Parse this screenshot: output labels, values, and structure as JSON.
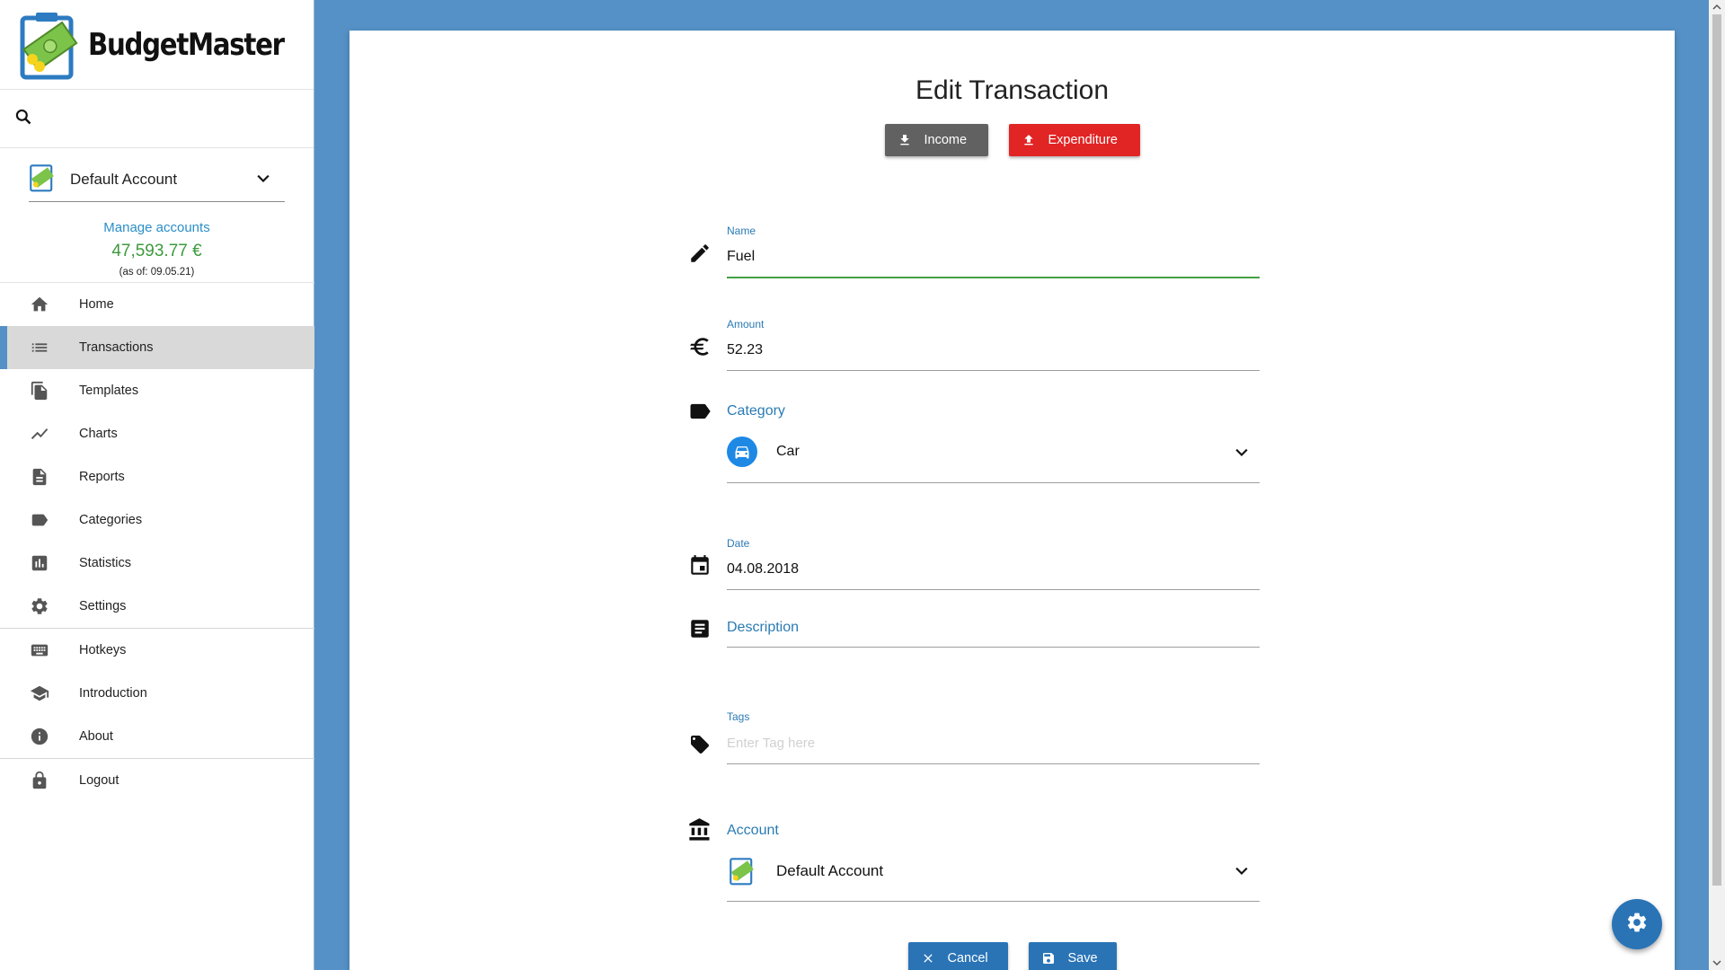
{
  "app": {
    "name": "BudgetMaster"
  },
  "sidebar": {
    "account": {
      "selected": "Default Account",
      "manage_label": "Manage accounts",
      "balance": "47,593.77 €",
      "as_of": "(as of: 09.05.21)"
    },
    "items": [
      {
        "label": "Home",
        "icon": "home-icon"
      },
      {
        "label": "Transactions",
        "icon": "list-icon",
        "active": true
      },
      {
        "label": "Templates",
        "icon": "file-copy-icon"
      },
      {
        "label": "Charts",
        "icon": "chart-line-icon"
      },
      {
        "label": "Reports",
        "icon": "document-icon"
      },
      {
        "label": "Categories",
        "icon": "label-icon"
      },
      {
        "label": "Statistics",
        "icon": "bar-chart-icon"
      },
      {
        "label": "Settings",
        "icon": "gear-icon"
      },
      {
        "label": "Hotkeys",
        "icon": "keyboard-icon"
      },
      {
        "label": "Introduction",
        "icon": "school-icon"
      },
      {
        "label": "About",
        "icon": "info-icon"
      },
      {
        "label": "Logout",
        "icon": "lock-icon"
      }
    ]
  },
  "form": {
    "title": "Edit Transaction",
    "income_label": "Income",
    "expenditure_label": "Expenditure",
    "name": {
      "label": "Name",
      "value": "Fuel"
    },
    "amount": {
      "label": "Amount",
      "value": "52.23"
    },
    "category": {
      "label": "Category",
      "value": "Car"
    },
    "date": {
      "label": "Date",
      "value": "04.08.2018"
    },
    "description": {
      "label": "Description",
      "value": ""
    },
    "tags": {
      "label": "Tags",
      "placeholder": "Enter Tag here"
    },
    "account": {
      "label": "Account",
      "value": "Default Account"
    },
    "cancel_label": "Cancel",
    "save_label": "Save"
  },
  "colors": {
    "background": "#5591c6",
    "primary": "#2a74b6",
    "expenditure": "#e12424",
    "income": "#616161",
    "balance": "#3c9a3c",
    "category_car": "#1e88e5"
  }
}
